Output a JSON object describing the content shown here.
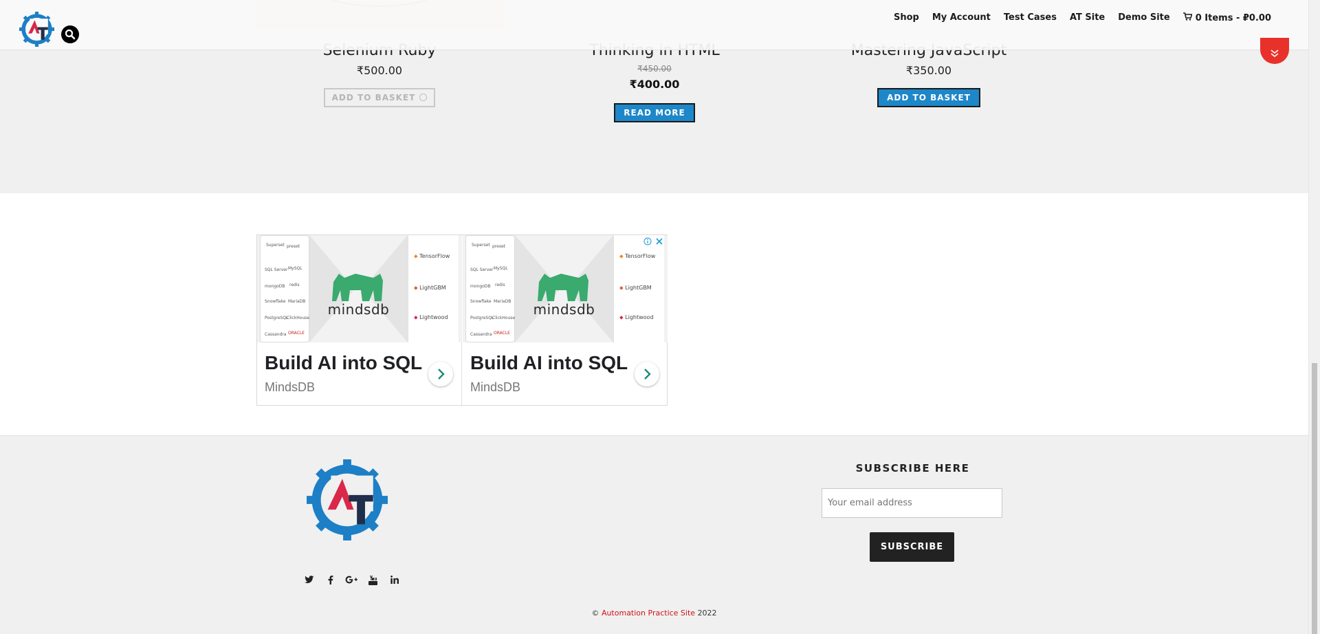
{
  "header": {
    "nav": [
      {
        "label": "Shop"
      },
      {
        "label": "My Account"
      },
      {
        "label": "Test Cases"
      },
      {
        "label": "AT Site"
      },
      {
        "label": "Demo Site"
      }
    ],
    "cart_label": "0 Items - ₽0.00"
  },
  "products": [
    {
      "title": "Selenium Ruby",
      "price": "₹500.00",
      "button": "ADD TO BASKET",
      "state": "loading"
    },
    {
      "title": "Thinking in HTML",
      "old_price": "₹450.00",
      "price": "₹400.00",
      "button": "READ MORE"
    },
    {
      "title": "Mastering JavaScript",
      "price": "₹350.00",
      "button": "ADD TO BASKET"
    }
  ],
  "ad": {
    "headline": "Build AI into SQL",
    "advertiser": "MindsDB",
    "brand": "mindsdb",
    "partners": [
      "TensorFlow",
      "LightGBM",
      "Lightwood"
    ],
    "sources": [
      "Superset",
      "preset",
      "SQL Server",
      "MySQL",
      "mongoDB",
      "redis",
      "Snowflake",
      "MariaDB",
      "PostgreSQL",
      "ClickHouse",
      "Cassandra",
      "ORACLE"
    ]
  },
  "footer": {
    "subscribe_title": "SUBSCRIBE HERE",
    "email_placeholder": "Your email address",
    "subscribe_button": "SUBSCRIBE",
    "copyright_symbol": "©",
    "copyright_link": "Automation Practice Site",
    "copyright_year": "2022"
  },
  "colors": {
    "accent_red": "#e8312a",
    "button_blue": "#1d87c9",
    "logo_blue": "#1d7fc6",
    "logo_red": "#d9284a",
    "logo_navy": "#1f2e4a",
    "mindsdb_green": "#3aaa6e",
    "link_red": "#d0111b"
  }
}
